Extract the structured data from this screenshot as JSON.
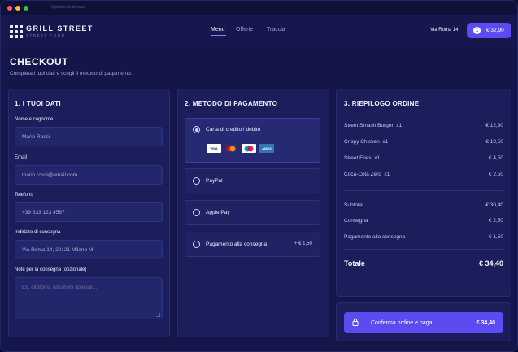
{
  "browser": {
    "url": "//grillstreet.it/menu"
  },
  "header": {
    "brand": "GRILL STREET",
    "brand_sub": "STREET FOOD",
    "nav": [
      {
        "label": "Menu",
        "active": true
      },
      {
        "label": "Offerte",
        "active": false
      },
      {
        "label": "Traccia",
        "active": false
      }
    ],
    "address": "Via Roma 14",
    "cart_count": "1",
    "cart_amount": "€ 32,90"
  },
  "page": {
    "title": "CHECKOUT",
    "subtitle": "Completa i tuoi dati e scegli il metodo di pagamento."
  },
  "details": {
    "title": "1. I TUOI DATI",
    "name_label": "Nome e cognome",
    "name_value": "Mario Rossi",
    "email_label": "Email",
    "email_value": "mario.rossi@email.com",
    "phone_label": "Telefono",
    "phone_value": "+39 333 123 4567",
    "address_label": "Indirizzo di consegna",
    "address_value": "Via Roma 14, 20121 Milano MI",
    "notes_label": "Note per la consegna (opzionale)",
    "notes_placeholder": "Es. citofono, istruzioni speciali..."
  },
  "payment": {
    "title": "2. METODO DI PAGAMENTO",
    "options": [
      {
        "label": "Carta di credito / debito",
        "selected": true,
        "extra": ""
      },
      {
        "label": "PayPal",
        "selected": false,
        "extra": ""
      },
      {
        "label": "Apple Pay",
        "selected": false,
        "extra": ""
      },
      {
        "label": "Pagamento alla consegna",
        "selected": false,
        "extra": "+ € 1,50"
      }
    ],
    "card_brands": [
      "VISA",
      "MC",
      "MAESTRO",
      "AMEX"
    ]
  },
  "summary": {
    "title": "3. RIEPILOGO ORDINE",
    "items": [
      {
        "name": "Street Smash Burger",
        "qty": "x1",
        "price": "€ 12,90"
      },
      {
        "name": "Crispy Chicken",
        "qty": "x1",
        "price": "€ 10,50"
      },
      {
        "name": "Street Fries",
        "qty": "x1",
        "price": "€ 4,50"
      },
      {
        "name": "Coca-Cola Zero",
        "qty": "x1",
        "price": "€ 2,50"
      }
    ],
    "subtotal_label": "Subtotal",
    "subtotal_value": "€ 30,40",
    "delivery_label": "Consegna",
    "delivery_value": "€ 2,50",
    "cod_label": "Pagamento alla consegna",
    "cod_value": "€ 1,50",
    "total_label": "Totale",
    "total_value": "€ 34,40",
    "confirm_label": "Conferma ordine e paga",
    "confirm_amount": "€ 34,40"
  },
  "colors": {
    "accent": "#5b4bf0",
    "background": "#14164a",
    "card": "#1b1e5a"
  }
}
